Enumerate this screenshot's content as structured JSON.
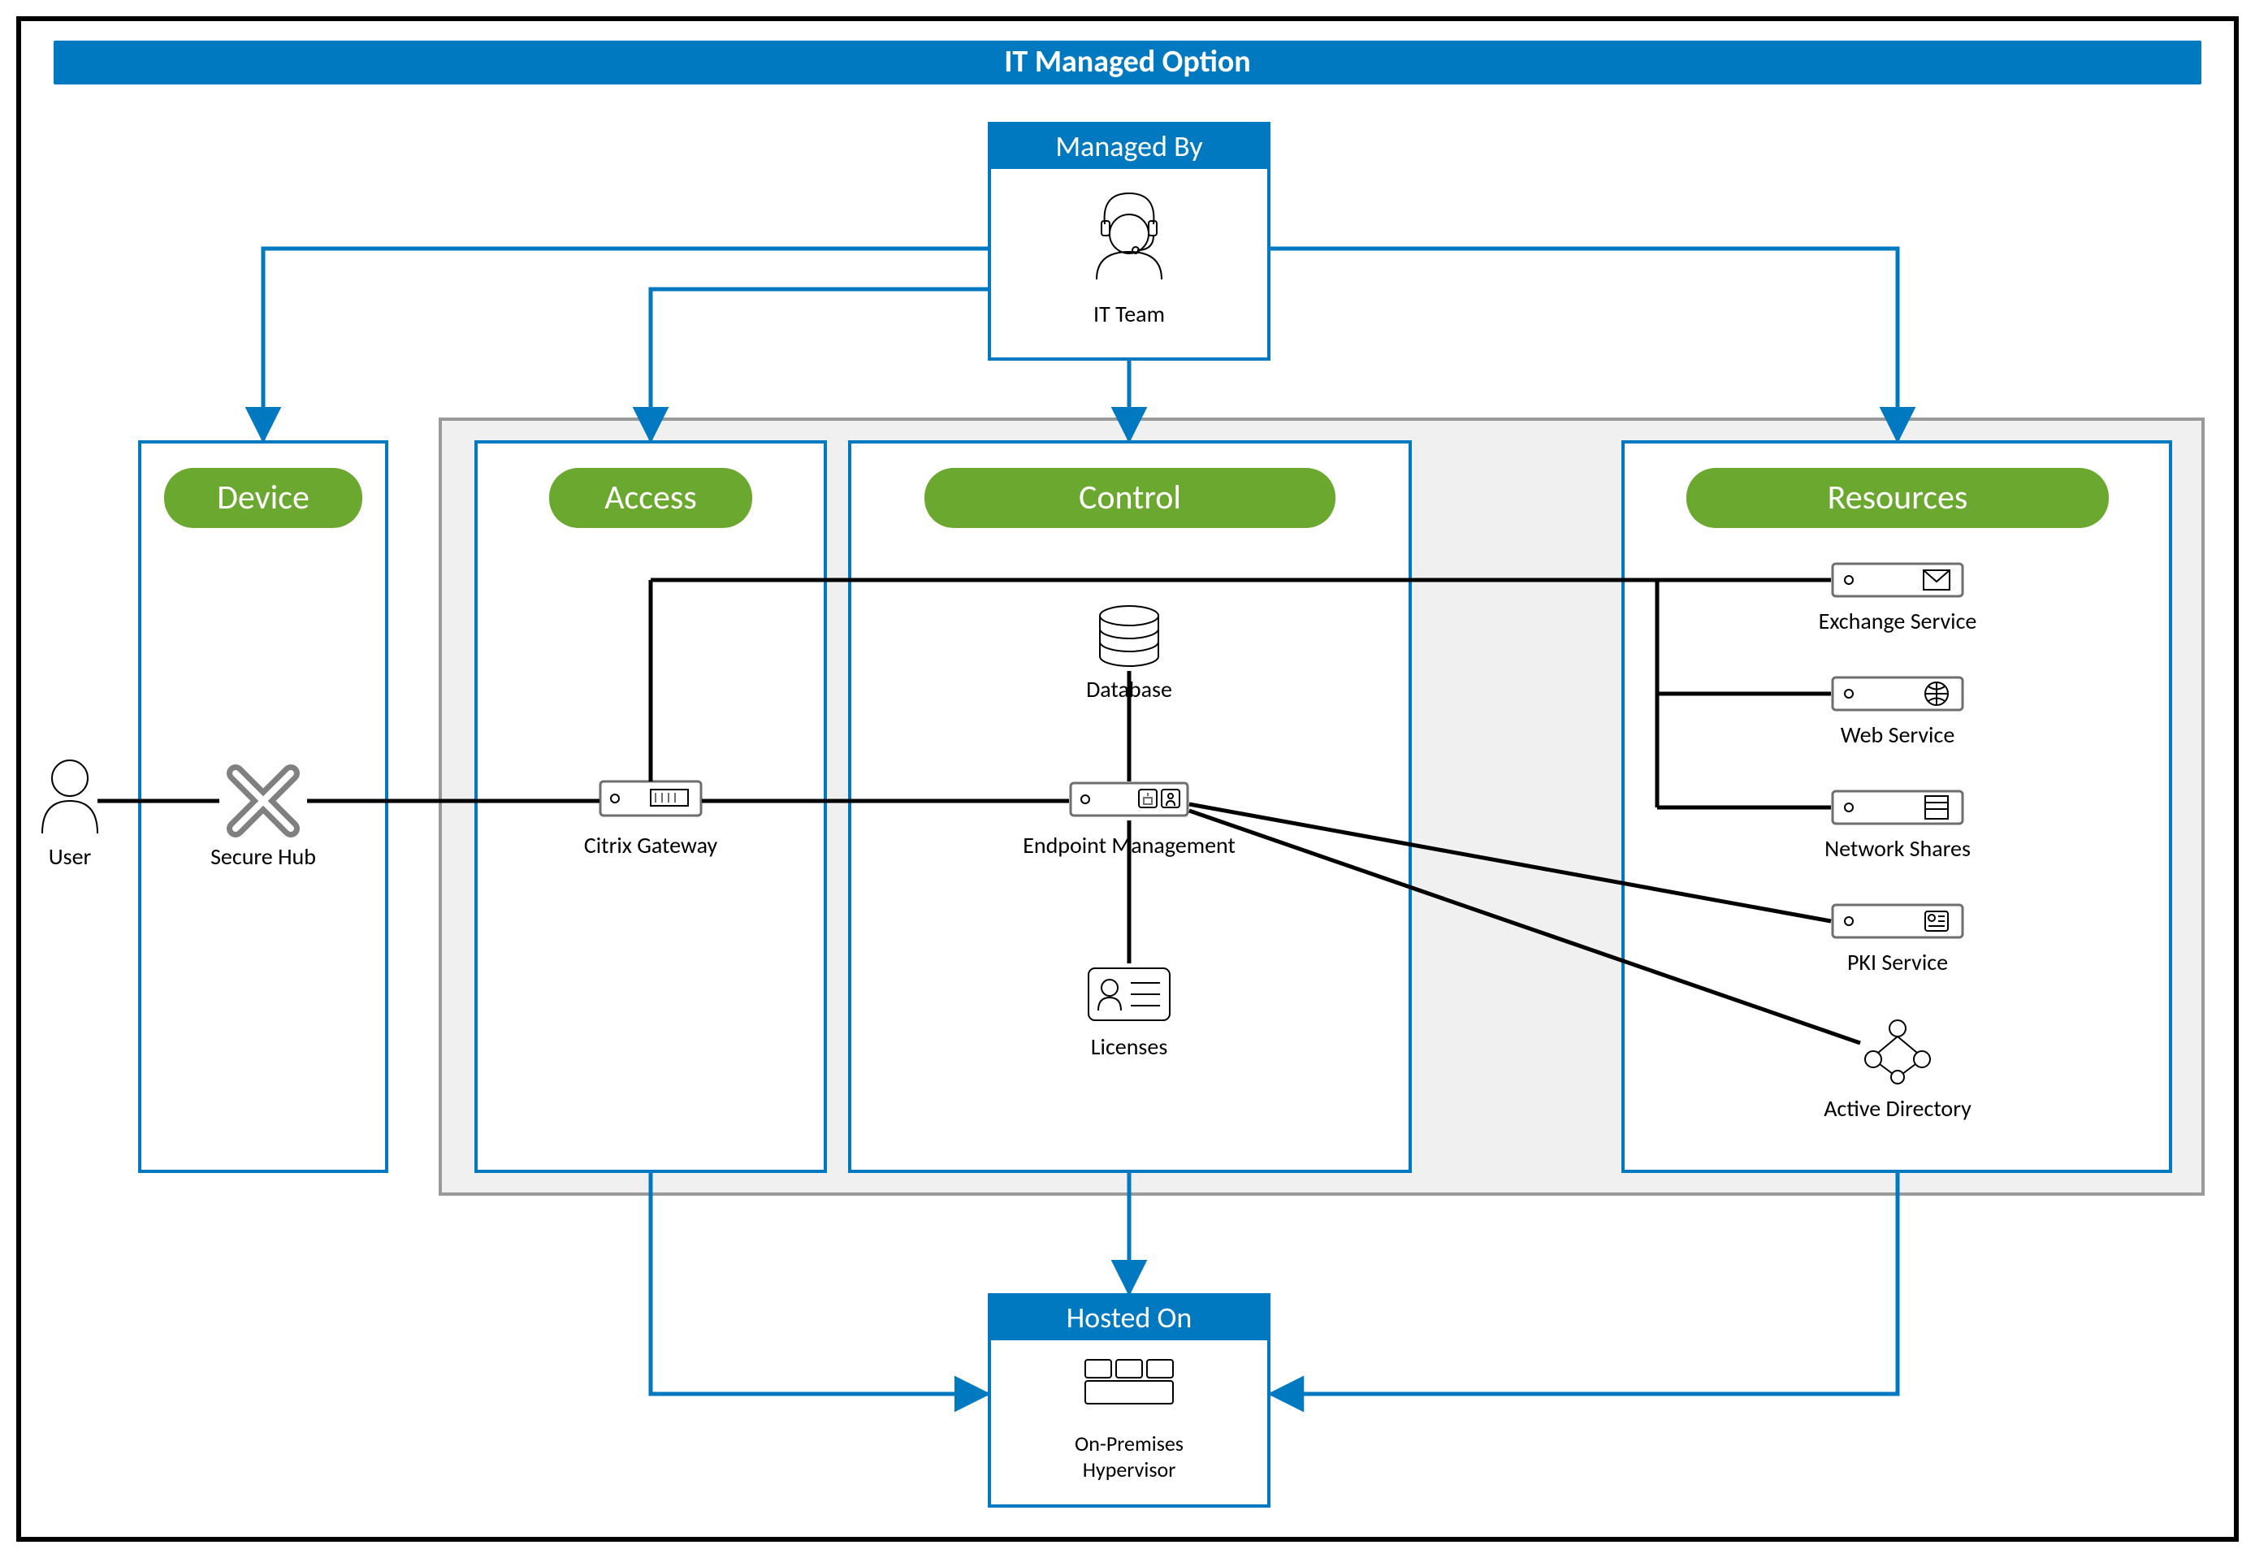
{
  "title": "IT Managed Option",
  "managed_by": {
    "header": "Managed By",
    "label": "IT Team"
  },
  "hosted_on": {
    "header": "Hosted On",
    "label_line1": "On-Premises",
    "label_line2": "Hypervisor"
  },
  "columns": {
    "device": {
      "pill": "Device",
      "user": "User",
      "secure_hub": "Secure Hub"
    },
    "access": {
      "pill": "Access",
      "gateway": "Citrix Gateway"
    },
    "control": {
      "pill": "Control",
      "database": "Database",
      "endpoint": "Endpoint Management",
      "licenses": "Licenses"
    },
    "resources": {
      "pill": "Resources",
      "exchange": "Exchange Service",
      "web": "Web Service",
      "network": "Network Shares",
      "pki": "PKI Service",
      "ad": "Active Directory"
    }
  },
  "colors": {
    "brand_blue": "#0079c1",
    "pill_green": "#6ba82f",
    "grey_panel": "#f0f0f0",
    "grey_border": "#9a9a9a"
  }
}
